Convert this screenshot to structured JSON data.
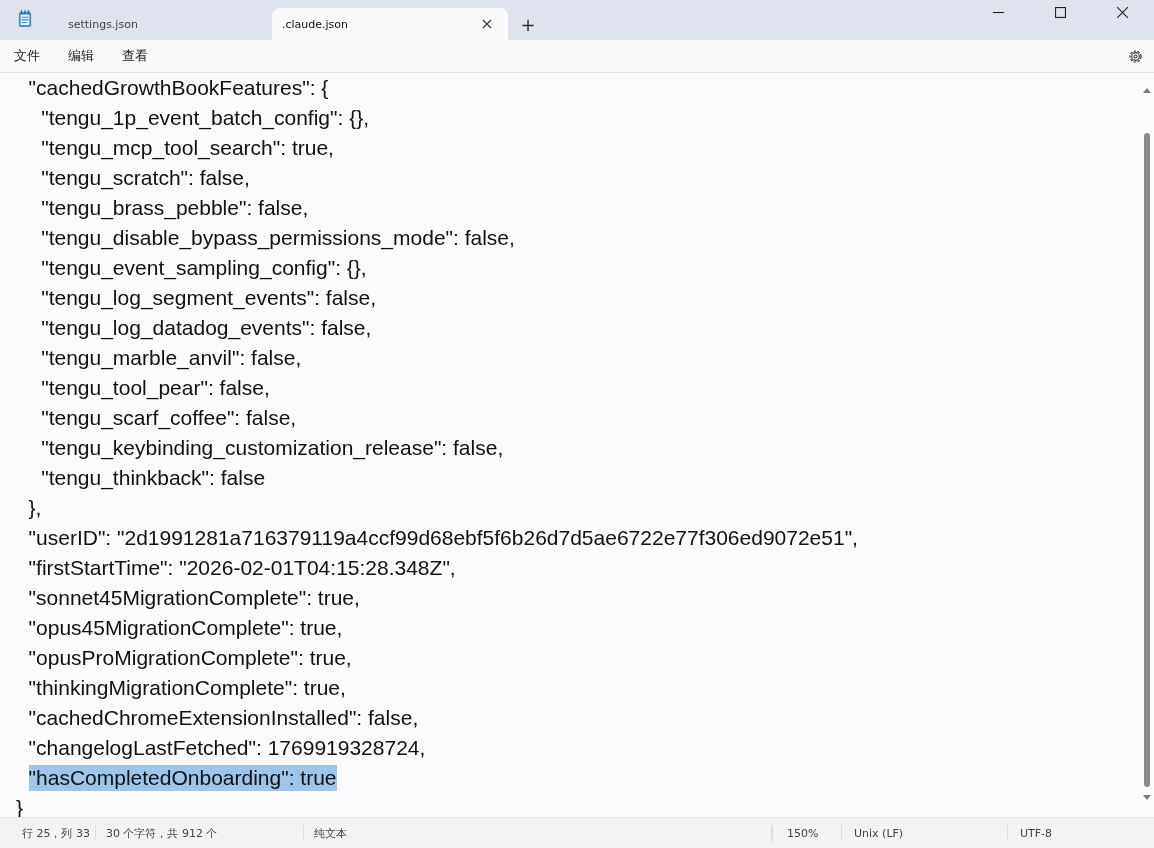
{
  "tabs": [
    {
      "label": "settings.json",
      "selected": false,
      "closable": false
    },
    {
      "label": ".claude.json",
      "selected": true,
      "closable": true
    }
  ],
  "new_tab": "+",
  "menu": [
    "文件",
    "编辑",
    "查看"
  ],
  "editor": {
    "lines": [
      {
        "text": "  \"cachedGrowthBookFeatures\": {",
        "selected": false
      },
      {
        "text": "    \"tengu_1p_event_batch_config\": {},",
        "selected": false
      },
      {
        "text": "    \"tengu_mcp_tool_search\": true,",
        "selected": false
      },
      {
        "text": "    \"tengu_scratch\": false,",
        "selected": false
      },
      {
        "text": "    \"tengu_brass_pebble\": false,",
        "selected": false
      },
      {
        "text": "    \"tengu_disable_bypass_permissions_mode\": false,",
        "selected": false
      },
      {
        "text": "    \"tengu_event_sampling_config\": {},",
        "selected": false
      },
      {
        "text": "    \"tengu_log_segment_events\": false,",
        "selected": false
      },
      {
        "text": "    \"tengu_log_datadog_events\": false,",
        "selected": false
      },
      {
        "text": "    \"tengu_marble_anvil\": false,",
        "selected": false
      },
      {
        "text": "    \"tengu_tool_pear\": false,",
        "selected": false
      },
      {
        "text": "    \"tengu_scarf_coffee\": false,",
        "selected": false
      },
      {
        "text": "    \"tengu_keybinding_customization_release\": false,",
        "selected": false
      },
      {
        "text": "    \"tengu_thinkback\": false",
        "selected": false
      },
      {
        "text": "  },",
        "selected": false
      },
      {
        "text": "  \"userID\": \"2d1991281a716379119a4ccf99d68ebf5f6b26d7d5ae6722e77f306ed9072e51\",",
        "selected": false
      },
      {
        "text": "  \"firstStartTime\": \"2026-02-01T04:15:28.348Z\",",
        "selected": false
      },
      {
        "text": "  \"sonnet45MigrationComplete\": true,",
        "selected": false
      },
      {
        "text": "  \"opus45MigrationComplete\": true,",
        "selected": false
      },
      {
        "text": "  \"opusProMigrationComplete\": true,",
        "selected": false
      },
      {
        "text": "  \"thinkingMigrationComplete\": true,",
        "selected": false
      },
      {
        "text": "  \"cachedChromeExtensionInstalled\": false,",
        "selected": false
      },
      {
        "text": "  \"changelogLastFetched\": 1769919328724,",
        "selected": false
      },
      {
        "text": "  \"hasCompletedOnboarding\": true",
        "selected": true
      },
      {
        "text": "}",
        "selected": false
      }
    ]
  },
  "status_bar": {
    "position": "行 25，列 33",
    "selection": "30 个字符，共 912 个",
    "format": "纯文本",
    "zoom": "150%",
    "line_ending": "Unix (LF)",
    "encoding": "UTF-8"
  }
}
